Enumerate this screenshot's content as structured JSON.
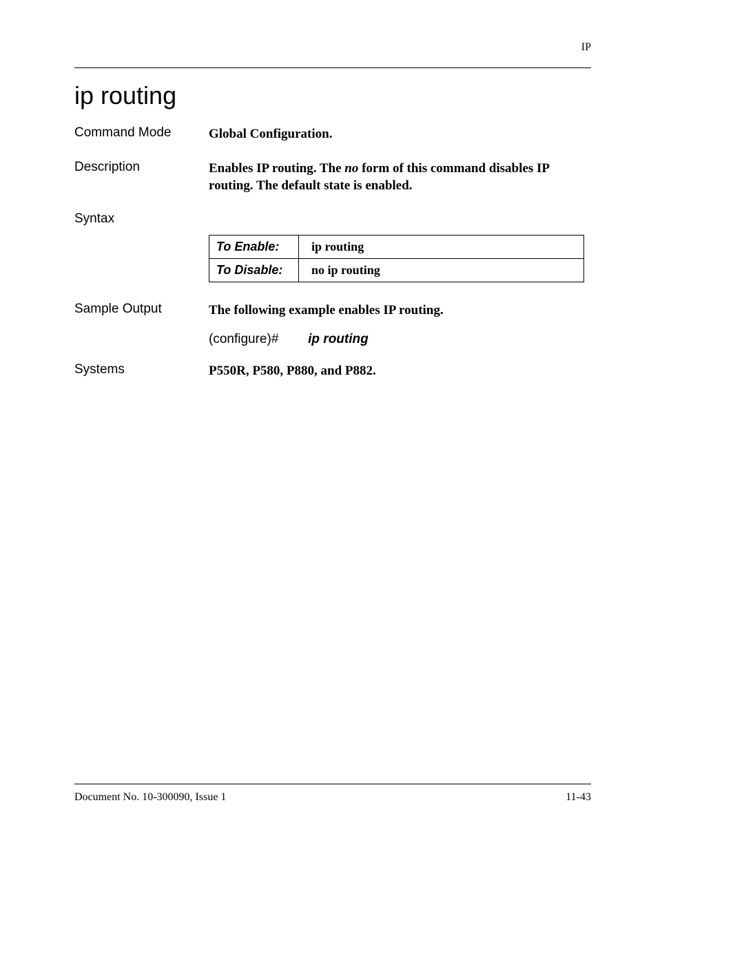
{
  "header": {
    "section": "IP"
  },
  "title": "ip routing",
  "command_mode": {
    "label": "Command Mode",
    "value": "Global Configuration."
  },
  "description": {
    "label": "Description",
    "part1": "Enables IP routing. The ",
    "no": "no",
    "part2": " form of this command disables IP routing. The default state is enabled."
  },
  "syntax": {
    "label": "Syntax",
    "rows": [
      {
        "header": "To Enable:",
        "command": "ip routing"
      },
      {
        "header": "To Disable:",
        "command": "no ip routing"
      }
    ]
  },
  "sample_output": {
    "label": "Sample Output",
    "intro": "The following example enables IP routing.",
    "prompt": "(configure)#",
    "command": "ip routing"
  },
  "systems": {
    "label": "Systems",
    "value": "P550R, P580, P880, and P882."
  },
  "footer": {
    "doc": "Document No. 10-300090, Issue 1",
    "page": "11-43"
  }
}
